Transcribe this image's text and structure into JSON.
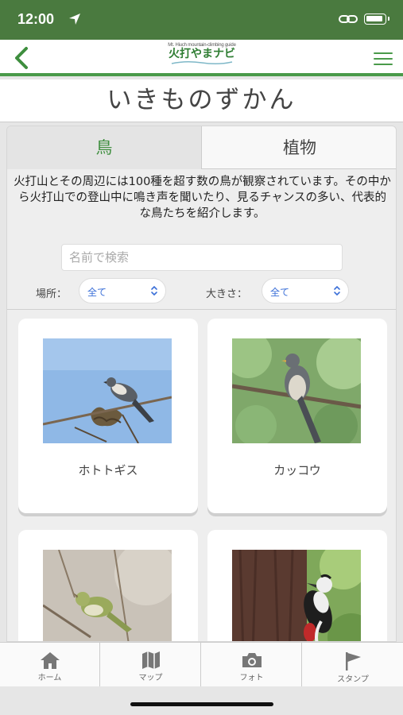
{
  "status_bar": {
    "time": "12:00"
  },
  "header": {
    "logo_subtitle": "Mt. Hiuch mountain-climbing guide",
    "logo_title": "火打やまナビ"
  },
  "page": {
    "title": "いきものずかん"
  },
  "tabs": [
    {
      "label": "鳥",
      "active": true
    },
    {
      "label": "植物",
      "active": false
    }
  ],
  "description": "火打山とその周辺には100種を超す数の鳥が観察されています。その中から火打山での登山中に鳴き声を聞いたり、見るチャンスの多い、代表的な鳥たちを紹介します。",
  "search": {
    "placeholder": "名前で検索"
  },
  "filters": {
    "location": {
      "label": "場所：",
      "value": "全て"
    },
    "size": {
      "label": "大きさ：",
      "value": "全て"
    }
  },
  "cards": [
    {
      "name": "ホトトギス",
      "image": "bird-perched-on-branch-blue-sky"
    },
    {
      "name": "カッコウ",
      "image": "bird-perched-on-branch-green-forest"
    },
    {
      "name": "",
      "image": "small-green-bird-on-branch"
    },
    {
      "name": "",
      "image": "woodpecker-on-tree-trunk"
    }
  ],
  "tabbar": [
    {
      "label": "ホーム",
      "icon": "home-icon"
    },
    {
      "label": "マップ",
      "icon": "map-icon"
    },
    {
      "label": "フォト",
      "icon": "camera-icon"
    },
    {
      "label": "スタンプ",
      "icon": "flag-icon"
    }
  ],
  "colors": {
    "brand_green": "#4a7a3f",
    "accent_green": "#3e8e3e",
    "link_blue": "#3a6fd8"
  }
}
